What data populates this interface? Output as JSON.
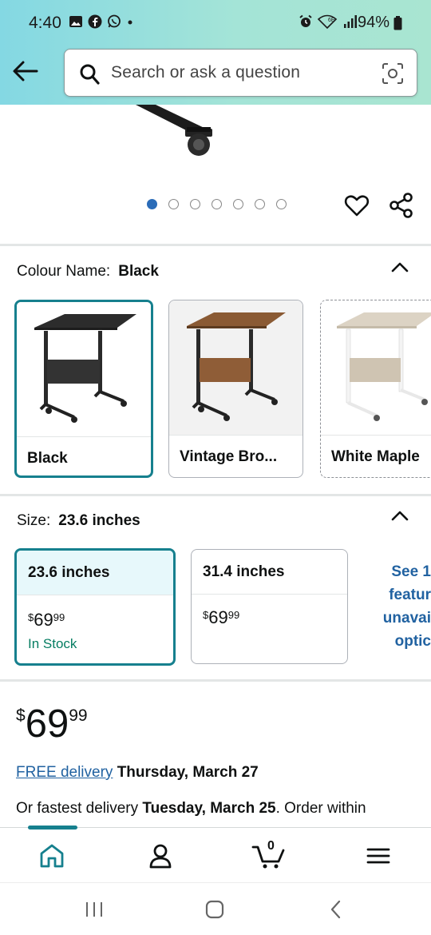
{
  "status": {
    "time": "4:40",
    "battery": "94%"
  },
  "search": {
    "placeholder": "Search or ask a question"
  },
  "gallery": {
    "image_count": 7,
    "active_index": 0
  },
  "colour": {
    "label": "Colour Name:",
    "selected": "Black",
    "options": [
      {
        "label": "Black"
      },
      {
        "label": "Vintage Bro..."
      },
      {
        "label": "White Maple"
      }
    ]
  },
  "size": {
    "label": "Size:",
    "selected": "23.6 inches",
    "options": [
      {
        "name": "23.6 inches",
        "price_symbol": "$",
        "price_whole": "69",
        "price_cents": "99",
        "stock": "In Stock"
      },
      {
        "name": "31.4 inches",
        "price_symbol": "$",
        "price_whole": "69",
        "price_cents": "99"
      }
    ],
    "see_more": [
      "See 1",
      "featur",
      "unavai",
      "optic"
    ]
  },
  "price": {
    "symbol": "$",
    "whole": "69",
    "cents": "99"
  },
  "delivery": {
    "free_link": "FREE delivery",
    "date": "Thursday, March 27",
    "fastest_prefix": "Or fastest delivery",
    "fastest_date": "Tuesday, March 25",
    "fastest_suffix": ". Order within"
  },
  "bottom_nav": {
    "cart_count": "0"
  },
  "colors": {
    "accent": "#16808e",
    "link": "#2162a1",
    "in_stock": "#067d62",
    "header_start": "#84d8e3",
    "header_end": "#a9e5d1"
  }
}
